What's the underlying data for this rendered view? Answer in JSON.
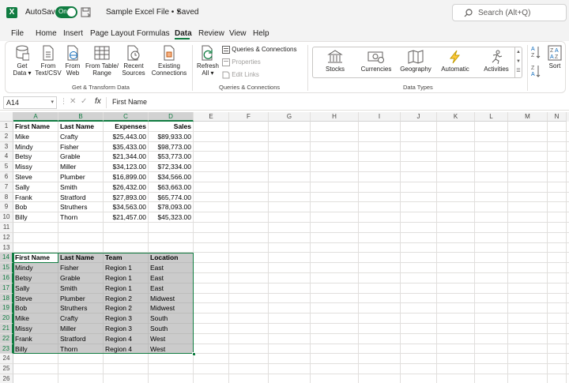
{
  "titlebar": {
    "app_icon": "X",
    "autosave_label": "AutoSave",
    "autosave_state": "On",
    "file_title": "Sample Excel File • Saved",
    "file_title_caret": "▾",
    "search_placeholder": "Search (Alt+Q)"
  },
  "menu": {
    "tabs": [
      "File",
      "Home",
      "Insert",
      "Page Layout",
      "Formulas",
      "Data",
      "Review",
      "View",
      "Help"
    ],
    "active": "Data"
  },
  "ribbon": {
    "get_transform": {
      "get_data": [
        "Get",
        "Data ▾"
      ],
      "from_text_csv": [
        "From",
        "Text/CSV"
      ],
      "from_web": [
        "From",
        "Web"
      ],
      "from_table_range": [
        "From Table/",
        "Range"
      ],
      "recent_sources": [
        "Recent",
        "Sources"
      ],
      "existing_connections": [
        "Existing",
        "Connections"
      ],
      "label": "Get & Transform Data"
    },
    "queries": {
      "refresh_all": [
        "Refresh",
        "All ▾"
      ],
      "queries_connections": "Queries & Connections",
      "properties": "Properties",
      "edit_links": "Edit Links",
      "label": "Queries & Connections"
    },
    "data_types": {
      "items": [
        "Stocks",
        "Currencies",
        "Geography",
        "Automatic",
        "Activities"
      ],
      "label": "Data Types"
    },
    "sort": {
      "sort_label": "Sort",
      "az": "A Z",
      "za": "Z A"
    }
  },
  "formula_bar": {
    "name_box": "A14",
    "fx": "fx",
    "content": "First Name"
  },
  "grid": {
    "columns": [
      "A",
      "B",
      "C",
      "D",
      "E",
      "F",
      "G",
      "H",
      "I",
      "J",
      "K",
      "L",
      "M",
      "N"
    ],
    "selected_columns": [
      "A",
      "B",
      "C",
      "D"
    ],
    "rows": [
      "1",
      "2",
      "3",
      "4",
      "5",
      "6",
      "7",
      "8",
      "9",
      "10",
      "11",
      "12",
      "13",
      "14",
      "15",
      "16",
      "17",
      "18",
      "19",
      "20",
      "21",
      "22",
      "23",
      "24",
      "25",
      "26"
    ],
    "selected_rows": [
      "14",
      "15",
      "16",
      "17",
      "18",
      "19",
      "20",
      "21",
      "22",
      "23"
    ],
    "table1": {
      "headers": [
        "First Name",
        "Last Name",
        "Expenses",
        "Sales"
      ],
      "rows": [
        [
          "Mike",
          "Crafty",
          "$25,443.00",
          "$89,933.00"
        ],
        [
          "Mindy",
          "Fisher",
          "$35,433.00",
          "$98,773.00"
        ],
        [
          "Betsy",
          "Grable",
          "$21,344.00",
          "$53,773.00"
        ],
        [
          "Missy",
          "Miller",
          "$34,123.00",
          "$72,334.00"
        ],
        [
          "Steve",
          "Plumber",
          "$16,899.00",
          "$34,566.00"
        ],
        [
          "Sally",
          "Smith",
          "$26,432.00",
          "$63,663.00"
        ],
        [
          "Frank",
          "Stratford",
          "$27,893.00",
          "$65,774.00"
        ],
        [
          "Bob",
          "Struthers",
          "$34,563.00",
          "$78,093.00"
        ],
        [
          "Billy",
          "Thorn",
          "$21,457.00",
          "$45,323.00"
        ]
      ]
    },
    "table2": {
      "headers": [
        "First Name",
        "Last Name",
        "Team",
        "Location"
      ],
      "rows": [
        [
          "Mindy",
          "Fisher",
          "Region 1",
          "East"
        ],
        [
          "Betsy",
          "Grable",
          "Region 1",
          "East"
        ],
        [
          "Sally",
          "Smith",
          "Region 1",
          "East"
        ],
        [
          "Steve",
          "Plumber",
          "Region 2",
          "Midwest"
        ],
        [
          "Bob",
          "Struthers",
          "Region 2",
          "Midwest"
        ],
        [
          "Mike",
          "Crafty",
          "Region 3",
          "South"
        ],
        [
          "Missy",
          "Miller",
          "Region 3",
          "South"
        ],
        [
          "Frank",
          "Stratford",
          "Region 4",
          "West"
        ],
        [
          "Billy",
          "Thorn",
          "Region 4",
          "West"
        ]
      ]
    }
  },
  "colors": {
    "accent": "#107c41",
    "chrome": "#f3f3f3",
    "selection_fill": "#a0a0a0"
  }
}
